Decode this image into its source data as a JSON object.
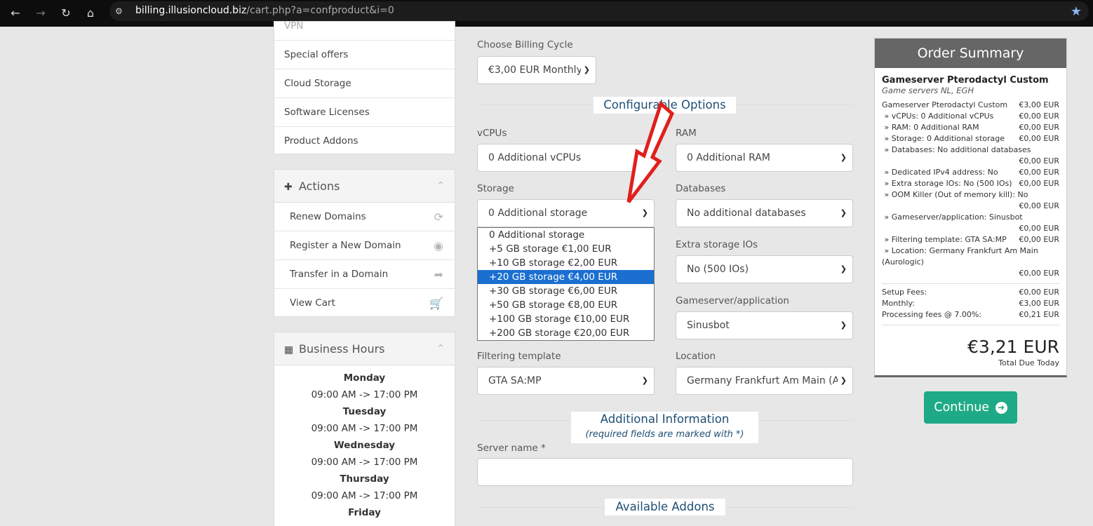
{
  "browser": {
    "url_host": "billing.illusioncloud.biz",
    "url_path": "/cart.php?a=confproduct&i=0"
  },
  "sidebar": {
    "categories": [
      {
        "label": "VPN"
      },
      {
        "label": "Special offers"
      },
      {
        "label": "Cloud Storage"
      },
      {
        "label": "Software Licenses"
      },
      {
        "label": "Product Addons"
      }
    ],
    "actions_title": "Actions",
    "actions": [
      {
        "label": "Renew Domains",
        "icon": "refresh-icon"
      },
      {
        "label": "Register a New Domain",
        "icon": "globe-icon"
      },
      {
        "label": "Transfer in a Domain",
        "icon": "share-icon"
      },
      {
        "label": "View Cart",
        "icon": "cart-icon"
      }
    ],
    "hours_title": "Business Hours",
    "hours": [
      {
        "day": "Monday",
        "time": "09:00 AM -> 17:00 PM"
      },
      {
        "day": "Tuesday",
        "time": "09:00 AM -> 17:00 PM"
      },
      {
        "day": "Wednesday",
        "time": "09:00 AM -> 17:00 PM"
      },
      {
        "day": "Thursday",
        "time": "09:00 AM -> 17:00 PM"
      },
      {
        "day": "Friday",
        "time": ""
      }
    ]
  },
  "form": {
    "billing_label": "Choose Billing Cycle",
    "billing_value": "€3,00 EUR Monthly",
    "config_title": "Configurable Options",
    "vcpus_label": "vCPUs",
    "vcpus_value": "0 Additional vCPUs",
    "ram_label": "RAM",
    "ram_value": "0 Additional RAM",
    "storage_label": "Storage",
    "storage_value": "0 Additional storage",
    "databases_label": "Databases",
    "databases_value": "No additional databases",
    "extra_io_label": "Extra storage IOs",
    "extra_io_value": "No (500 IOs)",
    "gameserver_label": "Gameserver/application",
    "gameserver_value": "Sinusbot",
    "filtering_label": "Filtering template",
    "filtering_value": "GTA SA:MP",
    "location_label": "Location",
    "location_value": "Germany Frankfurt Am Main (Au",
    "additional_title": "Additional Information",
    "additional_sub": "(required fields are marked with *)",
    "server_name_label": "Server name *",
    "addons_title": "Available Addons"
  },
  "storage_options": [
    "0 Additional storage",
    "+5 GB storage €1,00 EUR",
    "+10 GB storage €2,00 EUR",
    "+20 GB storage €4,00 EUR",
    "+30 GB storage €6,00 EUR",
    "+50 GB storage €8,00 EUR",
    "+100 GB storage €10,00 EUR",
    "+200 GB storage €20,00 EUR"
  ],
  "storage_selected_index": 3,
  "summary": {
    "title": "Order Summary",
    "product": "Gameserver Pterodactyl Custom",
    "group": "Game servers NL, EGH",
    "base_label": "Gameserver Pterodactyl Custom",
    "base_price": "€3,00 EUR",
    "lines": [
      {
        "label": "» vCPUs: 0 Additional vCPUs",
        "price": "€0,00 EUR"
      },
      {
        "label": "» RAM: 0 Additional RAM",
        "price": "€0,00 EUR"
      },
      {
        "label": "» Storage: 0 Additional storage",
        "price": "€0,00 EUR"
      },
      {
        "label": "» Databases: No additional databases",
        "price": "€0,00 EUR"
      },
      {
        "label": "» Dedicated IPv4 address: No",
        "price": "€0,00 EUR"
      },
      {
        "label": "» Extra storage IOs: No (500 IOs)",
        "price": "€0,00 EUR"
      },
      {
        "label": "» OOM Killer (Out of memory kill): No",
        "price": "€0,00 EUR"
      },
      {
        "label": "» Gameserver/application: Sinusbot",
        "price": "€0,00 EUR"
      },
      {
        "label": "» Filtering template: GTA SA:MP",
        "price": "€0,00 EUR"
      },
      {
        "label": "» Location: Germany Frankfurt Am Main (Aurologic)",
        "price": "€0,00 EUR"
      }
    ],
    "setup_label": "Setup Fees:",
    "setup_value": "€0,00 EUR",
    "monthly_label": "Monthly:",
    "monthly_value": "€3,00 EUR",
    "processing_label": "Processing fees @ 7.00%:",
    "processing_value": "€0,21 EUR",
    "total": "€3,21 EUR",
    "total_label": "Total Due Today"
  },
  "continue_label": "Continue",
  "colors": {
    "accent": "#1eaa86",
    "summary_header": "#666666",
    "link_blue": "#1f4e73",
    "selected_option": "#1a6fd1",
    "arrow": "#e0201c"
  }
}
